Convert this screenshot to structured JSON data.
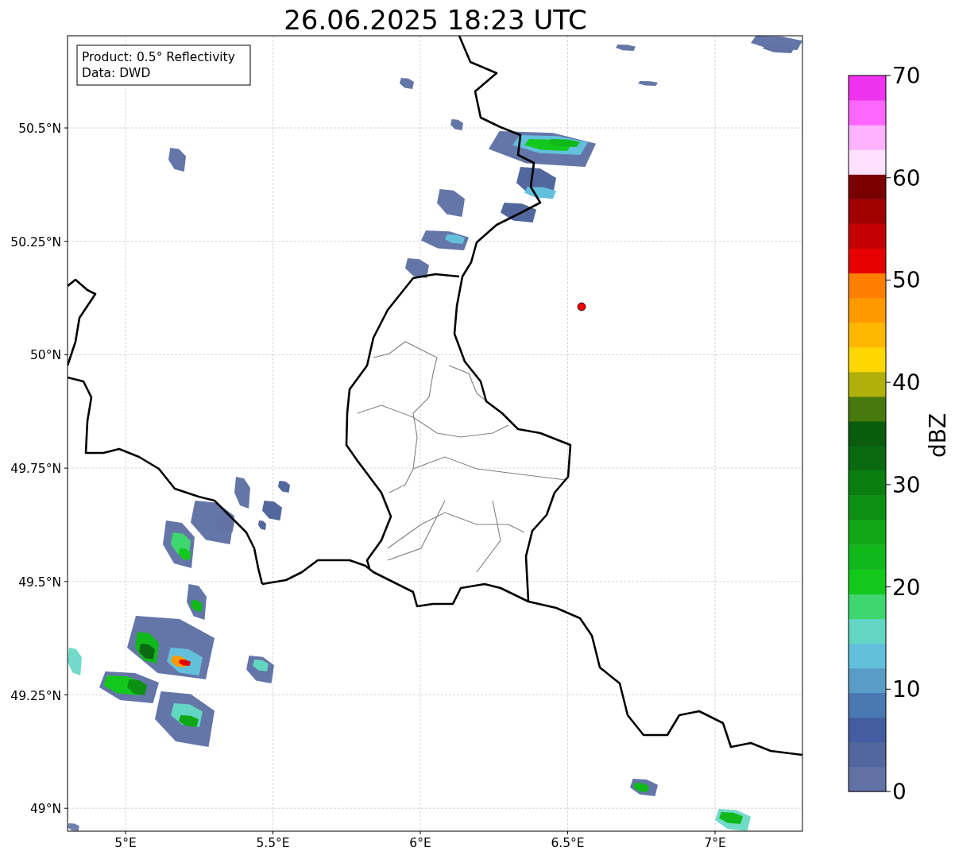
{
  "title": "26.06.2025 18:23 UTC",
  "info_box": {
    "lines": [
      "Product: 0.5° Reflectivity",
      "Data: DWD"
    ]
  },
  "map": {
    "lon_ticks": [
      "5°E",
      "5.5°E",
      "6°E",
      "6.5°E",
      "7°E"
    ],
    "lat_ticks": [
      "50.5°N",
      "50.25°N",
      "50°N",
      "49.75°N",
      "49.5°N",
      "49.25°N",
      "49°N"
    ]
  },
  "colorbar": {
    "label": "dBZ",
    "ticks": [
      "70",
      "60",
      "50",
      "40",
      "30",
      "20",
      "10",
      "0"
    ],
    "bands": [
      {
        "color": "#6272a4"
      },
      {
        "color": "#53679f"
      },
      {
        "color": "#435da0"
      },
      {
        "color": "#4a78b0"
      },
      {
        "color": "#5a9dc6"
      },
      {
        "color": "#63c0dc"
      },
      {
        "color": "#62d6c2"
      },
      {
        "color": "#3ed66e"
      },
      {
        "color": "#12c81a"
      },
      {
        "color": "#10b81a"
      },
      {
        "color": "#0fa716"
      },
      {
        "color": "#0c9014"
      },
      {
        "color": "#0b7e10"
      },
      {
        "color": "#0a6a10"
      },
      {
        "color": "#085c0c"
      },
      {
        "color": "#477a0c"
      },
      {
        "color": "#b0b00a"
      },
      {
        "color": "#ffd700"
      },
      {
        "color": "#ffb700"
      },
      {
        "color": "#ff9900"
      },
      {
        "color": "#ff7f00"
      },
      {
        "color": "#e60000"
      },
      {
        "color": "#c40000"
      },
      {
        "color": "#a00000"
      },
      {
        "color": "#7a0000"
      },
      {
        "color": "#ffe0ff"
      },
      {
        "color": "#ffb2ff"
      },
      {
        "color": "#ff66ff"
      },
      {
        "color": "#ee33ee"
      }
    ]
  }
}
